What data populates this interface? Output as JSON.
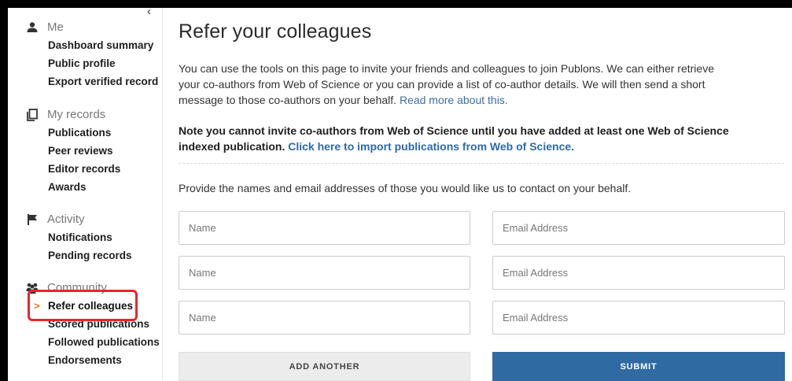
{
  "sidebar": {
    "sections": [
      {
        "title": "Me",
        "icon": "person-icon",
        "items": [
          "Dashboard summary",
          "Public profile",
          "Export verified record"
        ]
      },
      {
        "title": "My records",
        "icon": "copy-icon",
        "items": [
          "Publications",
          "Peer reviews",
          "Editor records",
          "Awards"
        ]
      },
      {
        "title": "Activity",
        "icon": "flag-icon",
        "items": [
          "Notifications",
          "Pending records"
        ]
      },
      {
        "title": "Community",
        "icon": "group-icon",
        "items": [
          "Refer colleagues",
          "Scored publications",
          "Followed publications",
          "Endorsements"
        ]
      }
    ],
    "active_item": "Refer colleagues",
    "collapse_glyph": "‹"
  },
  "main": {
    "title": "Refer your colleagues",
    "intro_text": "You can use the tools on this page to invite your friends and colleagues to join Publons. We can either retrieve your co-authors from Web of Science or you can provide a list of co-author details. We will then send a short message to those co-authors on your behalf. ",
    "intro_link": "Read more about this.",
    "note_text": "Note you cannot invite co-authors from Web of Science until you have added at least one Web of Science indexed publication. ",
    "note_link": "Click here to import publications from Web of Science.",
    "provide_text": "Provide the names and email addresses of those you would like us to contact on your behalf.",
    "name_placeholder": "Name",
    "email_placeholder": "Email Address",
    "add_another_label": "ADD ANOTHER",
    "submit_label": "SUBMIT"
  },
  "colors": {
    "accent": "#2f6aa3",
    "link": "#3a6fa8",
    "active_arrow": "#e8771e",
    "highlight": "#e8262a"
  }
}
